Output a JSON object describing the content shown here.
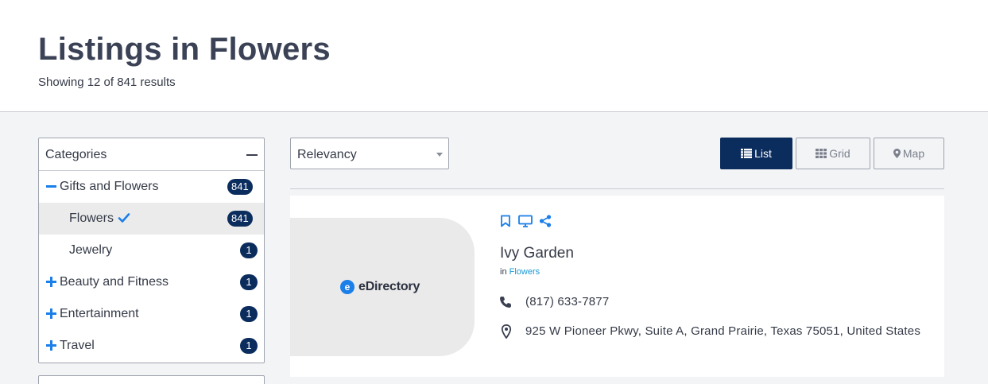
{
  "header": {
    "title": "Listings in Flowers",
    "results": "Showing 12 of 841 results"
  },
  "sidebar": {
    "title": "Categories",
    "items": [
      {
        "label": "Gifts and Flowers",
        "count": "841",
        "sign": "minus"
      },
      {
        "label": "Flowers",
        "count": "841",
        "active": true,
        "checked": true
      },
      {
        "label": "Jewelry",
        "count": "1"
      },
      {
        "label": "Beauty and Fitness",
        "count": "1",
        "sign": "plus"
      },
      {
        "label": "Entertainment",
        "count": "1",
        "sign": "plus"
      },
      {
        "label": "Travel",
        "count": "1",
        "sign": "plus"
      }
    ]
  },
  "sort": {
    "selected": "Relevancy"
  },
  "views": {
    "list": "List",
    "grid": "Grid",
    "map": "Map",
    "active": "list"
  },
  "listing": {
    "logo_mark": "e",
    "logo_text": "eDirectory",
    "title": "Ivy Garden",
    "in_prefix": "in",
    "category": "Flowers",
    "phone": "(817) 633-7877",
    "address": "925 W Pioneer Pkwy, Suite A, Grand Prairie, Texas 75051, United States",
    "icons": [
      "bookmark-icon",
      "monitor-icon",
      "share-icon",
      "phone-icon",
      "map-pin-icon"
    ]
  },
  "colors": {
    "accent": "#1a7fe8",
    "navy": "#0b2d5e",
    "link": "#1a9ad6",
    "text": "#353a47",
    "title": "#3b4256"
  }
}
